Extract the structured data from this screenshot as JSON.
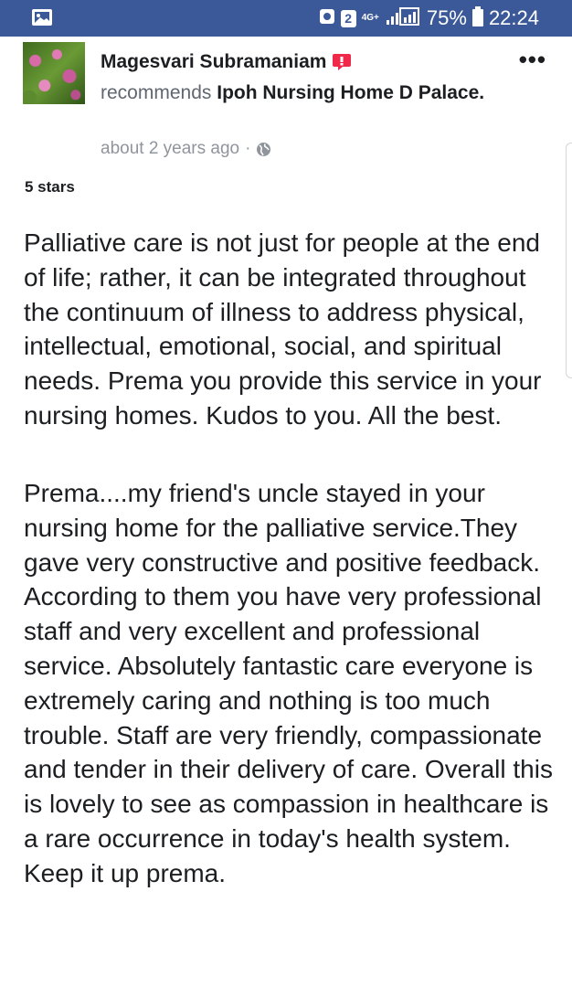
{
  "status_bar": {
    "left_icon": "image-icon",
    "network": "4G+",
    "battery": "75%",
    "time": "22:24",
    "sim_label": "2"
  },
  "post": {
    "author": "Magesvari Subramaniam",
    "author_badge_icon": "review-badge-icon",
    "more_icon": "•••",
    "verb": "recommends",
    "page_name": "Ipoh Nursing Home D Palace.",
    "timestamp": "about 2 years ago",
    "separator": "·",
    "privacy_icon": "globe-icon",
    "rating_label": "5 stars",
    "paragraphs": [
      "Palliative care is not just for people at the end of life; rather, it can be integrated throughout the continuum of illness to address physical, intellectual, emotional, social, and spiritual needs. Prema you provide this service in your nursing homes. Kudos to you. All the best.",
      "Prema....my friend's uncle stayed in your nursing home for the palliative service.They gave very constructive and positive feedback. According to them you have very professional staff and very excellent and professional service. Absolutely fantastic care everyone is extremely caring and nothing is too much trouble. Staff are very friendly, compassionate and tender in their delivery of care. Overall this is lovely to see as compassion in healthcare is a rare occurrence in today's health system. Keep it up prema."
    ]
  },
  "colors": {
    "status_bar_bg": "#3b5998",
    "text": "#1c1e21",
    "meta": "#90949c",
    "badge": "#f0284a"
  }
}
